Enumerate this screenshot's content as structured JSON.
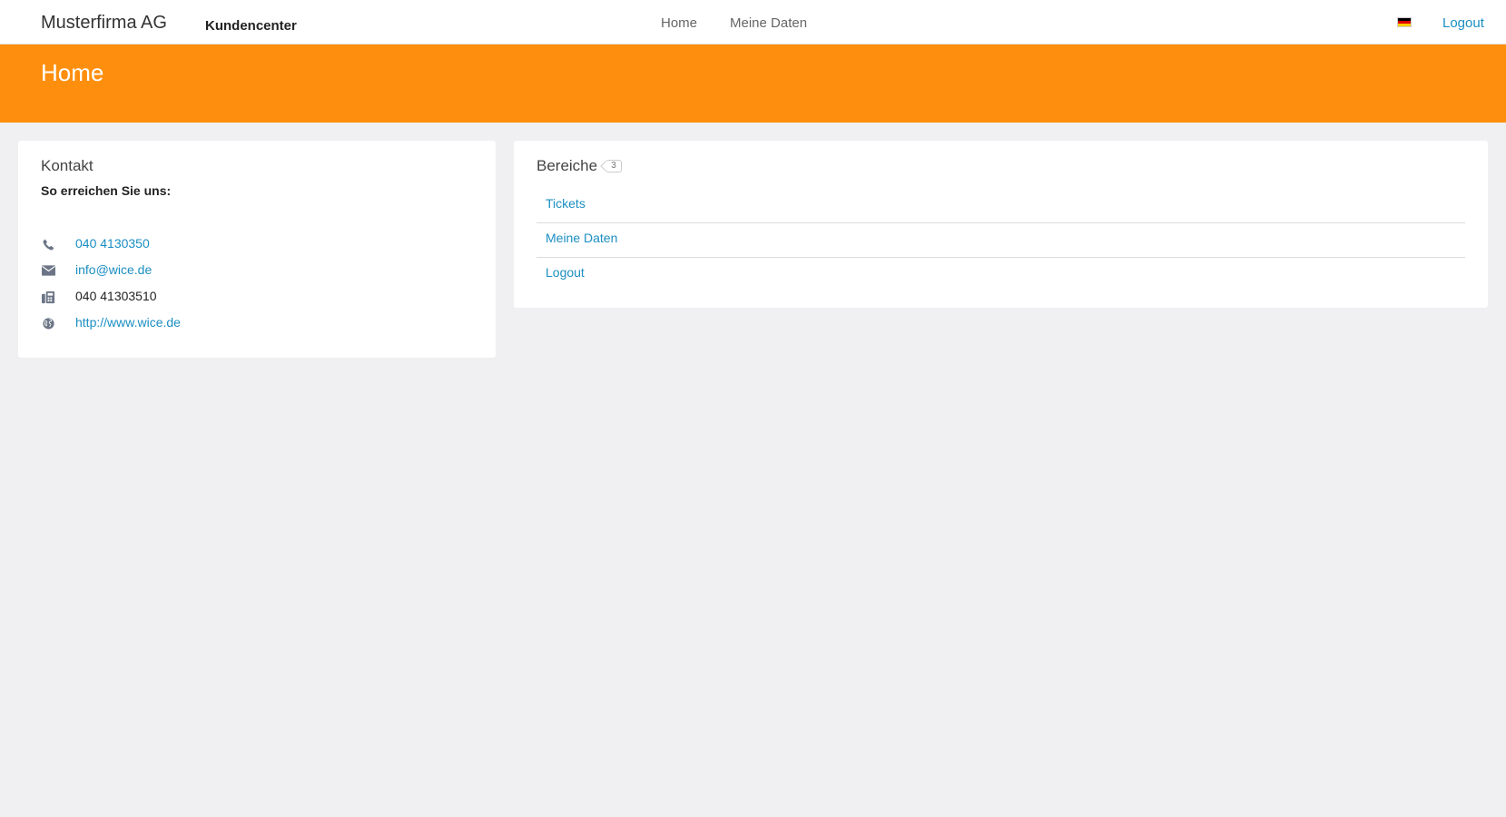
{
  "header": {
    "brand": "Musterfirma AG",
    "subbrand": "Kundencenter",
    "nav": [
      {
        "label": "Home"
      },
      {
        "label": "Meine Daten"
      }
    ],
    "language_flag": "de-flag-icon",
    "logout_label": "Logout"
  },
  "banner": {
    "title": "Home",
    "color": "#fe8f0e"
  },
  "contact": {
    "title": "Kontakt",
    "subtitle": "So erreichen Sie uns:",
    "rows": [
      {
        "icon": "phone-icon",
        "value": "040 4130350",
        "is_link": true
      },
      {
        "icon": "envelope-icon",
        "value": "info@wice.de",
        "is_link": true
      },
      {
        "icon": "fax-icon",
        "value": "040 41303510",
        "is_link": false
      },
      {
        "icon": "globe-icon",
        "value": "http://www.wice.de",
        "is_link": true
      }
    ]
  },
  "areas": {
    "title": "Bereiche",
    "count": "3",
    "items": [
      {
        "label": "Tickets"
      },
      {
        "label": "Meine Daten"
      },
      {
        "label": "Logout"
      }
    ]
  },
  "colors": {
    "link": "#1b8ec2",
    "background": "#f0f0f2"
  }
}
